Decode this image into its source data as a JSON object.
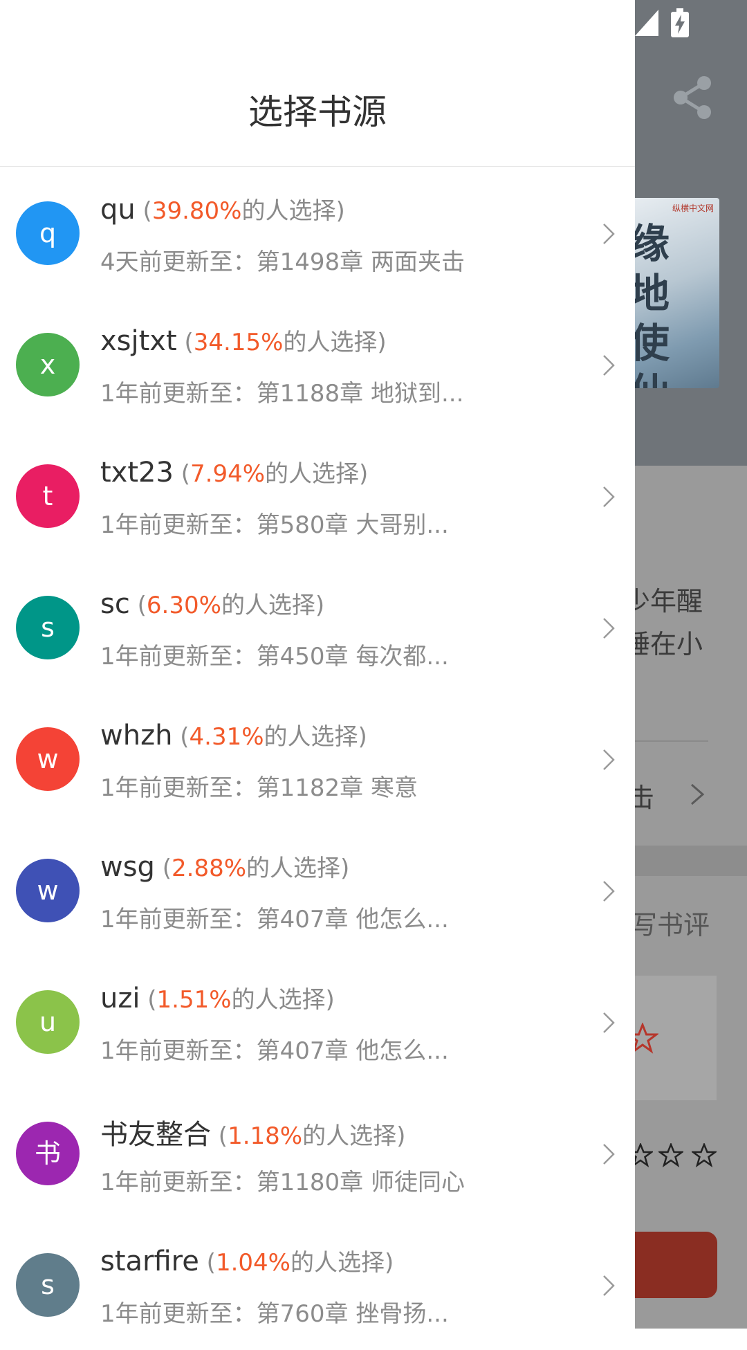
{
  "drawer": {
    "title": "选择书源",
    "sources": [
      {
        "initial": "q",
        "name": "qu",
        "pct": "39.80%",
        "suffix": "的人选择)",
        "update": "4天前更新至：第1498章 两面夹击",
        "color": "#2196F3"
      },
      {
        "initial": "x",
        "name": "xsjtxt",
        "pct": "34.15%",
        "suffix": "的人选择)",
        "update": "1年前更新至：第1188章 地狱到...",
        "color": "#4CAF50"
      },
      {
        "initial": "t",
        "name": "txt23",
        "pct": "7.94%",
        "suffix": "的人选择)",
        "update": "1年前更新至：第580章 大哥别...",
        "color": "#E91E63"
      },
      {
        "initial": "s",
        "name": "sc",
        "pct": "6.30%",
        "suffix": "的人选择)",
        "update": "1年前更新至：第450章 每次都...",
        "color": "#009688"
      },
      {
        "initial": "w",
        "name": "whzh",
        "pct": "4.31%",
        "suffix": "的人选择)",
        "update": "1年前更新至：第1182章 寒意",
        "color": "#F44336"
      },
      {
        "initial": "w",
        "name": "wsg",
        "pct": "2.88%",
        "suffix": "的人选择)",
        "update": "1年前更新至：第407章 他怎么...",
        "color": "#3F51B5"
      },
      {
        "initial": "u",
        "name": "uzi",
        "pct": "1.51%",
        "suffix": "的人选择)",
        "update": "1年前更新至：第407章 他怎么...",
        "color": "#8BC34A"
      },
      {
        "initial": "书",
        "name": "书友整合",
        "pct": "1.18%",
        "suffix": "的人选择)",
        "update": "1年前更新至：第1180章 师徒同心",
        "color": "#9C27B0"
      },
      {
        "initial": "s",
        "name": "starfire",
        "pct": "1.04%",
        "suffix": "的人选择)",
        "update": "1年前更新至：第760章 挫骨扬...",
        "color": "#607D8B"
      }
    ]
  },
  "background": {
    "cover_title": "缘地使仙",
    "cover_badge": "纵横中文网",
    "intro_line1": "少年醒",
    "intro_line2": "睡在小",
    "chapter_snippet": "击",
    "write_review": "写书评"
  },
  "colors": {
    "accent_pct": "#f25a2a",
    "primary_text": "#333333",
    "secondary_text": "#8c8c8c",
    "overlay_header": "#6f7479",
    "button_red": "#8a2d22"
  }
}
